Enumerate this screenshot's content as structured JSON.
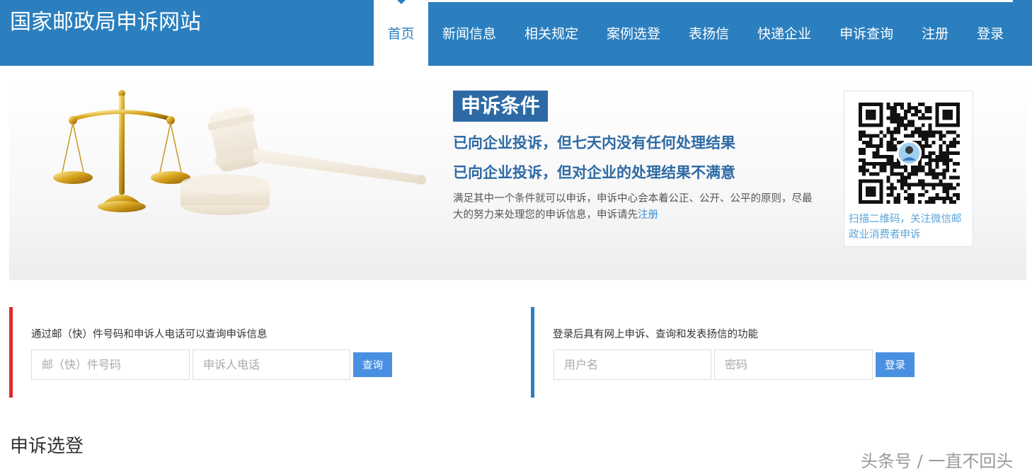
{
  "header": {
    "site_title": "国家邮政局申诉网站",
    "brand_color": "#2b7fbf",
    "nav": [
      {
        "label": "首页",
        "active": true
      },
      {
        "label": "新闻信息",
        "active": false
      },
      {
        "label": "相关规定",
        "active": false
      },
      {
        "label": "案例选登",
        "active": false
      },
      {
        "label": "表扬信",
        "active": false
      },
      {
        "label": "快递企业",
        "active": false
      },
      {
        "label": "申诉查询",
        "active": false
      },
      {
        "label": "注册",
        "active": false
      },
      {
        "label": "登录",
        "active": false
      }
    ]
  },
  "banner": {
    "art_icons": [
      "scales-of-justice-icon",
      "gavel-icon"
    ],
    "condition_title": "申诉条件",
    "condition_1": "已向企业投诉，但七天内没有任何处理结果",
    "condition_2": "已向企业投诉，但对企业的处理结果不满意",
    "description": "满足其中一个条件就可以申诉，申诉中心会本着公正、公开、公平的原则，尽最大的努力来处理您的申诉信息，申诉请先",
    "register_link": "注册",
    "qr_caption": "扫描二维码，关注微信邮政业消费者申诉"
  },
  "query_panel": {
    "hint": "通过邮（快）件号码和申诉人电话可以查询申诉信息",
    "tracking_placeholder": "邮（快）件号码",
    "phone_placeholder": "申诉人电话",
    "button": "查询",
    "accent_color": "#e02b2b"
  },
  "login_panel": {
    "hint": "登录后具有网上申诉、查询和发表扬信的功能",
    "username_placeholder": "用户名",
    "password_placeholder": "密码",
    "button": "登录",
    "accent_color": "#2d7fc0"
  },
  "section_title": "申诉选登",
  "watermark": "头条号 / 一直不回头"
}
